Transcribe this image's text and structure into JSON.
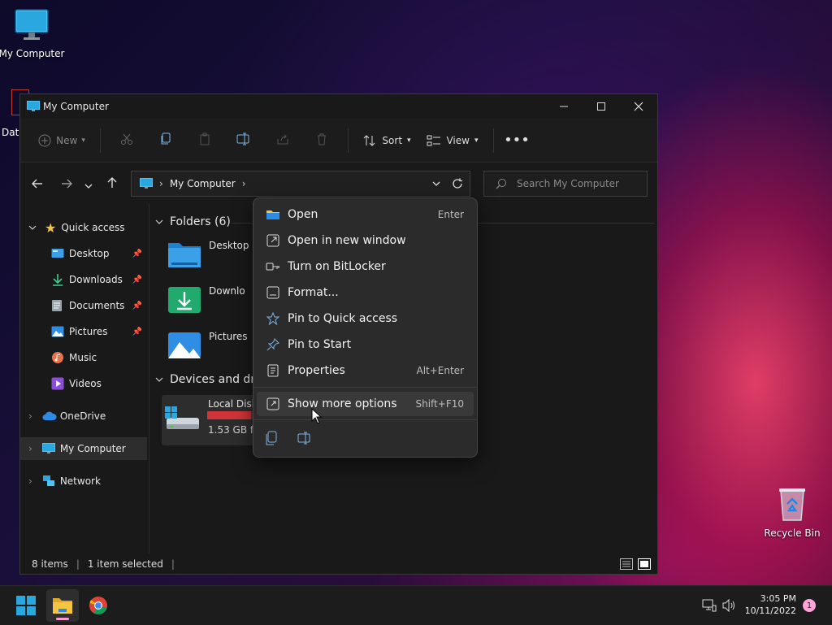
{
  "desktop": {
    "my_computer_label": "My Computer",
    "recycle_bin_label": "Recycle Bin",
    "partial_label": "Data"
  },
  "window": {
    "title": "My Computer",
    "toolbar": {
      "new_label": "New",
      "sort_label": "Sort",
      "view_label": "View"
    },
    "address": {
      "path": "My Computer",
      "search_placeholder": "Search My Computer"
    },
    "sidebar": {
      "quick_access": "Quick access",
      "items": [
        {
          "label": "Desktop"
        },
        {
          "label": "Downloads"
        },
        {
          "label": "Documents"
        },
        {
          "label": "Pictures"
        },
        {
          "label": "Music"
        },
        {
          "label": "Videos"
        }
      ],
      "onedrive": "OneDrive",
      "my_computer": "My Computer",
      "network": "Network"
    },
    "content": {
      "folders_header": "Folders (6)",
      "folders": [
        {
          "label": "Desktop"
        },
        {
          "label": "Downloads"
        },
        {
          "label": "Pictures"
        }
      ],
      "devices_header": "Devices and drives",
      "disk_label": "Local Disk",
      "disk_free": "1.53 GB free",
      "disk_usage_fraction": 0.96
    },
    "status": {
      "items": "8 items",
      "selected": "1 item selected"
    }
  },
  "context_menu": {
    "items": [
      {
        "label": "Open",
        "shortcut": "Enter"
      },
      {
        "label": "Open in new window",
        "shortcut": ""
      },
      {
        "label": "Turn on BitLocker",
        "shortcut": ""
      },
      {
        "label": "Format...",
        "shortcut": ""
      },
      {
        "label": "Pin to Quick access",
        "shortcut": ""
      },
      {
        "label": "Pin to Start",
        "shortcut": ""
      },
      {
        "label": "Properties",
        "shortcut": "Alt+Enter"
      }
    ],
    "more": {
      "label": "Show more options",
      "shortcut": "Shift+F10"
    }
  },
  "taskbar": {
    "time": "3:05 PM",
    "date": "10/11/2022",
    "notification_count": "1"
  },
  "colors": {
    "accent": "#0078d4",
    "disk_bar": "#d13438",
    "folder_yellow": "#f4c542",
    "folder_blue": "#3aa0e8"
  }
}
